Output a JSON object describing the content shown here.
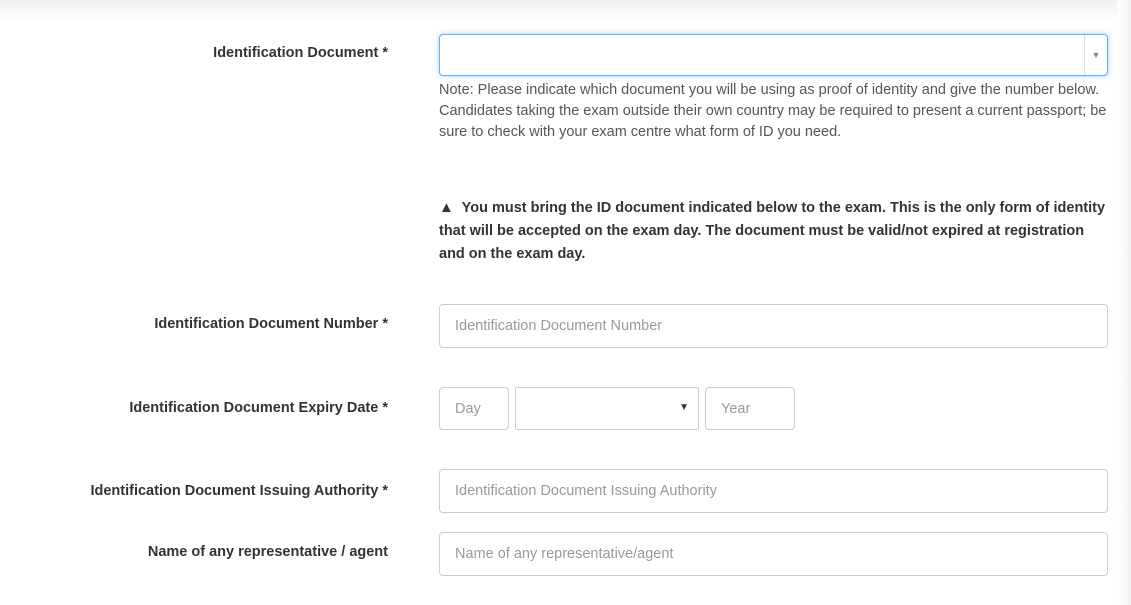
{
  "fields": {
    "id_document": {
      "label": "Identification Document *",
      "selected_value": "",
      "note": "Note: Please indicate which document you will be using as proof of identity and give the number below. Candidates taking the exam outside their own country may be required to present a current passport; be sure to check with your exam centre what form of ID you need.",
      "warning": "You must bring the ID document indicated below to the exam. This is the only form of identity that will be accepted on the exam day. The document must be valid/not expired at registration and on the exam day.",
      "warning_icon": "warning-triangle-icon",
      "warning_glyph": "▲"
    },
    "id_number": {
      "label": "Identification Document Number *",
      "placeholder": "Identification Document Number"
    },
    "expiry_date": {
      "label": "Identification Document Expiry Date *",
      "day_placeholder": "Day",
      "month_selected": "",
      "year_placeholder": "Year"
    },
    "issuing_authority": {
      "label": "Identification Document Issuing Authority *",
      "placeholder": "Identification Document Issuing Authority"
    },
    "representative": {
      "label": "Name of any representative / agent",
      "placeholder": "Name of any representative/agent"
    }
  },
  "colors": {
    "focus_border": "#66afe9",
    "input_border": "#cccccc",
    "placeholder": "#999999",
    "label_text": "#333333"
  }
}
